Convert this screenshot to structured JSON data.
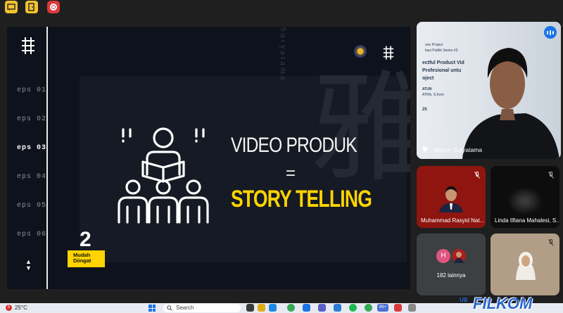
{
  "slide": {
    "episodes": [
      "eps 01",
      "eps 02",
      "eps 03",
      "eps 04",
      "eps 05",
      "eps 06"
    ],
    "active_episode_index": 2,
    "watermark_vertical": "Suryatama",
    "number": "2",
    "badge_line1": "Mudah",
    "badge_line2": "Diingat",
    "title_line1": "VIDEO PRODUK",
    "equals": "=",
    "title_line2": "STORY TELLING"
  },
  "speaker": {
    "name": "Mayun Suryatama",
    "poster_lines": [
      "ono Project",
      "kasi Publik Series #3",
      "ectful Product Vid",
      "Profesional untu",
      "oject",
      "ATUN",
      "ATRA, S.Kom",
      "25"
    ]
  },
  "participants": [
    {
      "name": "Muhammad Rasyid Nat..."
    },
    {
      "name": "Linda Ilfiana Mahalesi, S..."
    },
    {
      "name": "182 lainnya",
      "avatar_letter": "H"
    },
    {
      "name": ""
    }
  ],
  "taskbar": {
    "weather_badge": "5",
    "temperature": "25°C",
    "search_placeholder": "Search",
    "notification_count": "99+"
  },
  "brand": {
    "text": "FILKOM",
    "prefix": "UB"
  },
  "colors": {
    "accent_yellow": "#ffd400",
    "record_red": "#d93b3b",
    "speaking_blue": "#1a73e8"
  }
}
